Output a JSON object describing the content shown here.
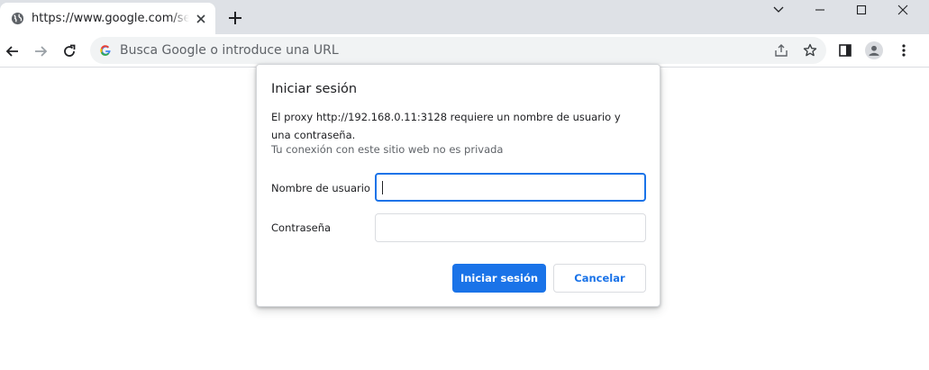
{
  "browser": {
    "tab": {
      "title": "https://www.google.com/search?q",
      "favicon": "globe-icon",
      "close": "close-icon"
    },
    "new_tab": "plus-icon",
    "window_controls": [
      "chevron-down-icon",
      "minimize-icon",
      "maximize-icon",
      "close-icon"
    ],
    "toolbar": {
      "back": "arrow-left-icon",
      "forward": "arrow-right-icon",
      "reload": "reload-icon",
      "omnibox_placeholder": "Busca Google o introduce una URL",
      "right_icons": [
        "share-icon",
        "star-icon",
        "side-panel-icon",
        "profile-icon",
        "more-icon"
      ]
    }
  },
  "dialog": {
    "title": "Iniciar sesión",
    "message": "El proxy http://192.168.0.11:3128 requiere un nombre de usuario y una contraseña.",
    "privacy_note": "Tu conexión con este sitio web no es privada",
    "username_label": "Nombre de usuario",
    "username_value": "",
    "password_label": "Contraseña",
    "password_value": "",
    "submit_label": "Iniciar sesión",
    "cancel_label": "Cancelar"
  },
  "colors": {
    "accent": "#1a73e8",
    "tabstrip": "#dee1e6",
    "omnibox": "#f1f3f4"
  }
}
